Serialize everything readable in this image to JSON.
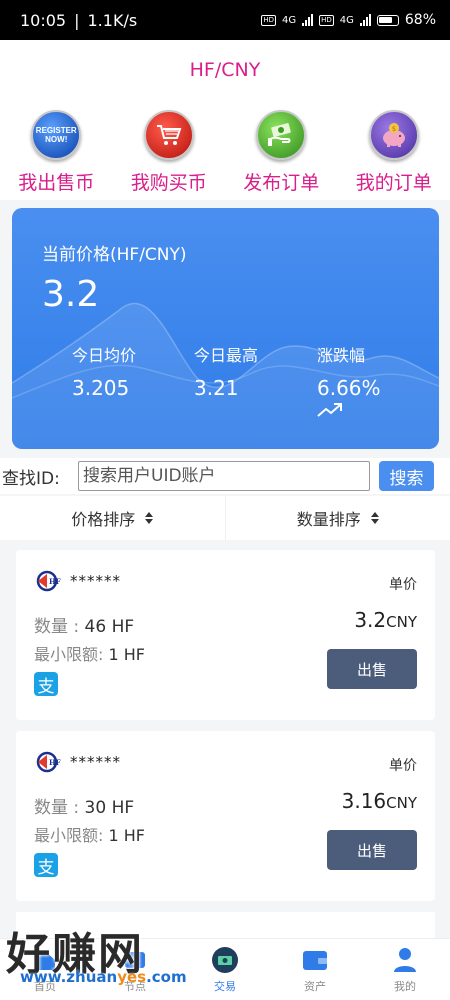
{
  "status_bar": {
    "time": "10:05",
    "speed": "1.1K/s",
    "network_1": "4G",
    "network_2": "4G",
    "battery": "68%"
  },
  "header": {
    "title": "HF/CNY"
  },
  "quick_actions": [
    {
      "label": "我出售币",
      "icon": "register-now-icon",
      "icon_text": "REGISTER NOW!"
    },
    {
      "label": "我购买币",
      "icon": "shopping-cart-icon"
    },
    {
      "label": "发布订单",
      "icon": "money-hand-icon"
    },
    {
      "label": "我的订单",
      "icon": "piggy-bank-icon"
    }
  ],
  "price_card": {
    "label": "当前价格(HF/CNY)",
    "price": "3.2",
    "avg_label": "今日均价",
    "avg_value": "3.205",
    "high_label": "今日最高",
    "high_value": "3.21",
    "change_label": "涨跌幅",
    "change_value": "6.66%"
  },
  "search": {
    "label": "查找ID:",
    "placeholder": "搜索用户UID账户",
    "button": "搜索"
  },
  "sort": {
    "price_label": "价格排序",
    "quantity_label": "数量排序"
  },
  "listings": [
    {
      "user": "******",
      "unit_label": "单价",
      "price": "3.2",
      "currency": "CNY",
      "qty_label": "数量 :",
      "qty_value": "46  HF",
      "min_label": "最小限额:",
      "min_value": "1  HF",
      "pay_icon": "支",
      "action": "出售"
    },
    {
      "user": "******",
      "unit_label": "单价",
      "price": "3.16",
      "currency": "CNY",
      "qty_label": "数量 :",
      "qty_value": "30  HF",
      "min_label": "最小限额:",
      "min_value": "1  HF",
      "pay_icon": "支",
      "action": "出售"
    }
  ],
  "tabbar": [
    {
      "label": "首页",
      "icon": "home-icon"
    },
    {
      "label": "节点",
      "icon": "node-icon"
    },
    {
      "label": "交易",
      "icon": "trade-icon",
      "active": true
    },
    {
      "label": "资产",
      "icon": "wallet-icon"
    },
    {
      "label": "我的",
      "icon": "user-icon"
    }
  ],
  "watermark": {
    "brand": "好赚网",
    "url_prefix": "www.zhuan",
    "url_highlight": "yes",
    "url_suffix": ".com"
  },
  "colors": {
    "accent": "#d91f8c",
    "card_blue": "#3580ea",
    "sell_button": "#4b5d7a",
    "search_button": "#4a8ff0"
  }
}
